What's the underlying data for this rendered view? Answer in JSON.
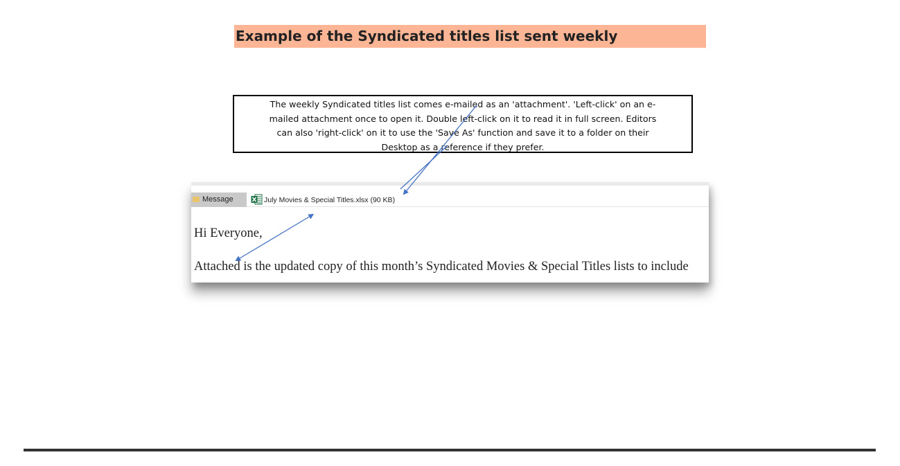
{
  "slide": {
    "title": "Example of the Syndicated titles list sent weekly",
    "callout_lines": [
      "The weekly Syndicated titles list comes e-mailed as an 'attachment'.  'Left-click' on an e-",
      "mailed attachment once to open it.  Double left-click on it to read it in full screen.  Editors",
      "can also  'right-click' on it to use the 'Save As' function and save it to a folder on their",
      "Desktop as a reference if they prefer."
    ]
  },
  "email": {
    "message_tab_label": "Message",
    "attachment_label": "July Movies & Special Titles.xlsx (90 KB)",
    "attachment_icon": "excel-file-icon",
    "greeting": "Hi Everyone,",
    "body_line": "Attached is the updated copy of this month’s Syndicated Movies & Special Titles lists to include "
  },
  "colors": {
    "title_highlight": "#fcb595",
    "arrow": "#4472c4",
    "rule": "#333333",
    "excel_green": "#1e7145"
  }
}
